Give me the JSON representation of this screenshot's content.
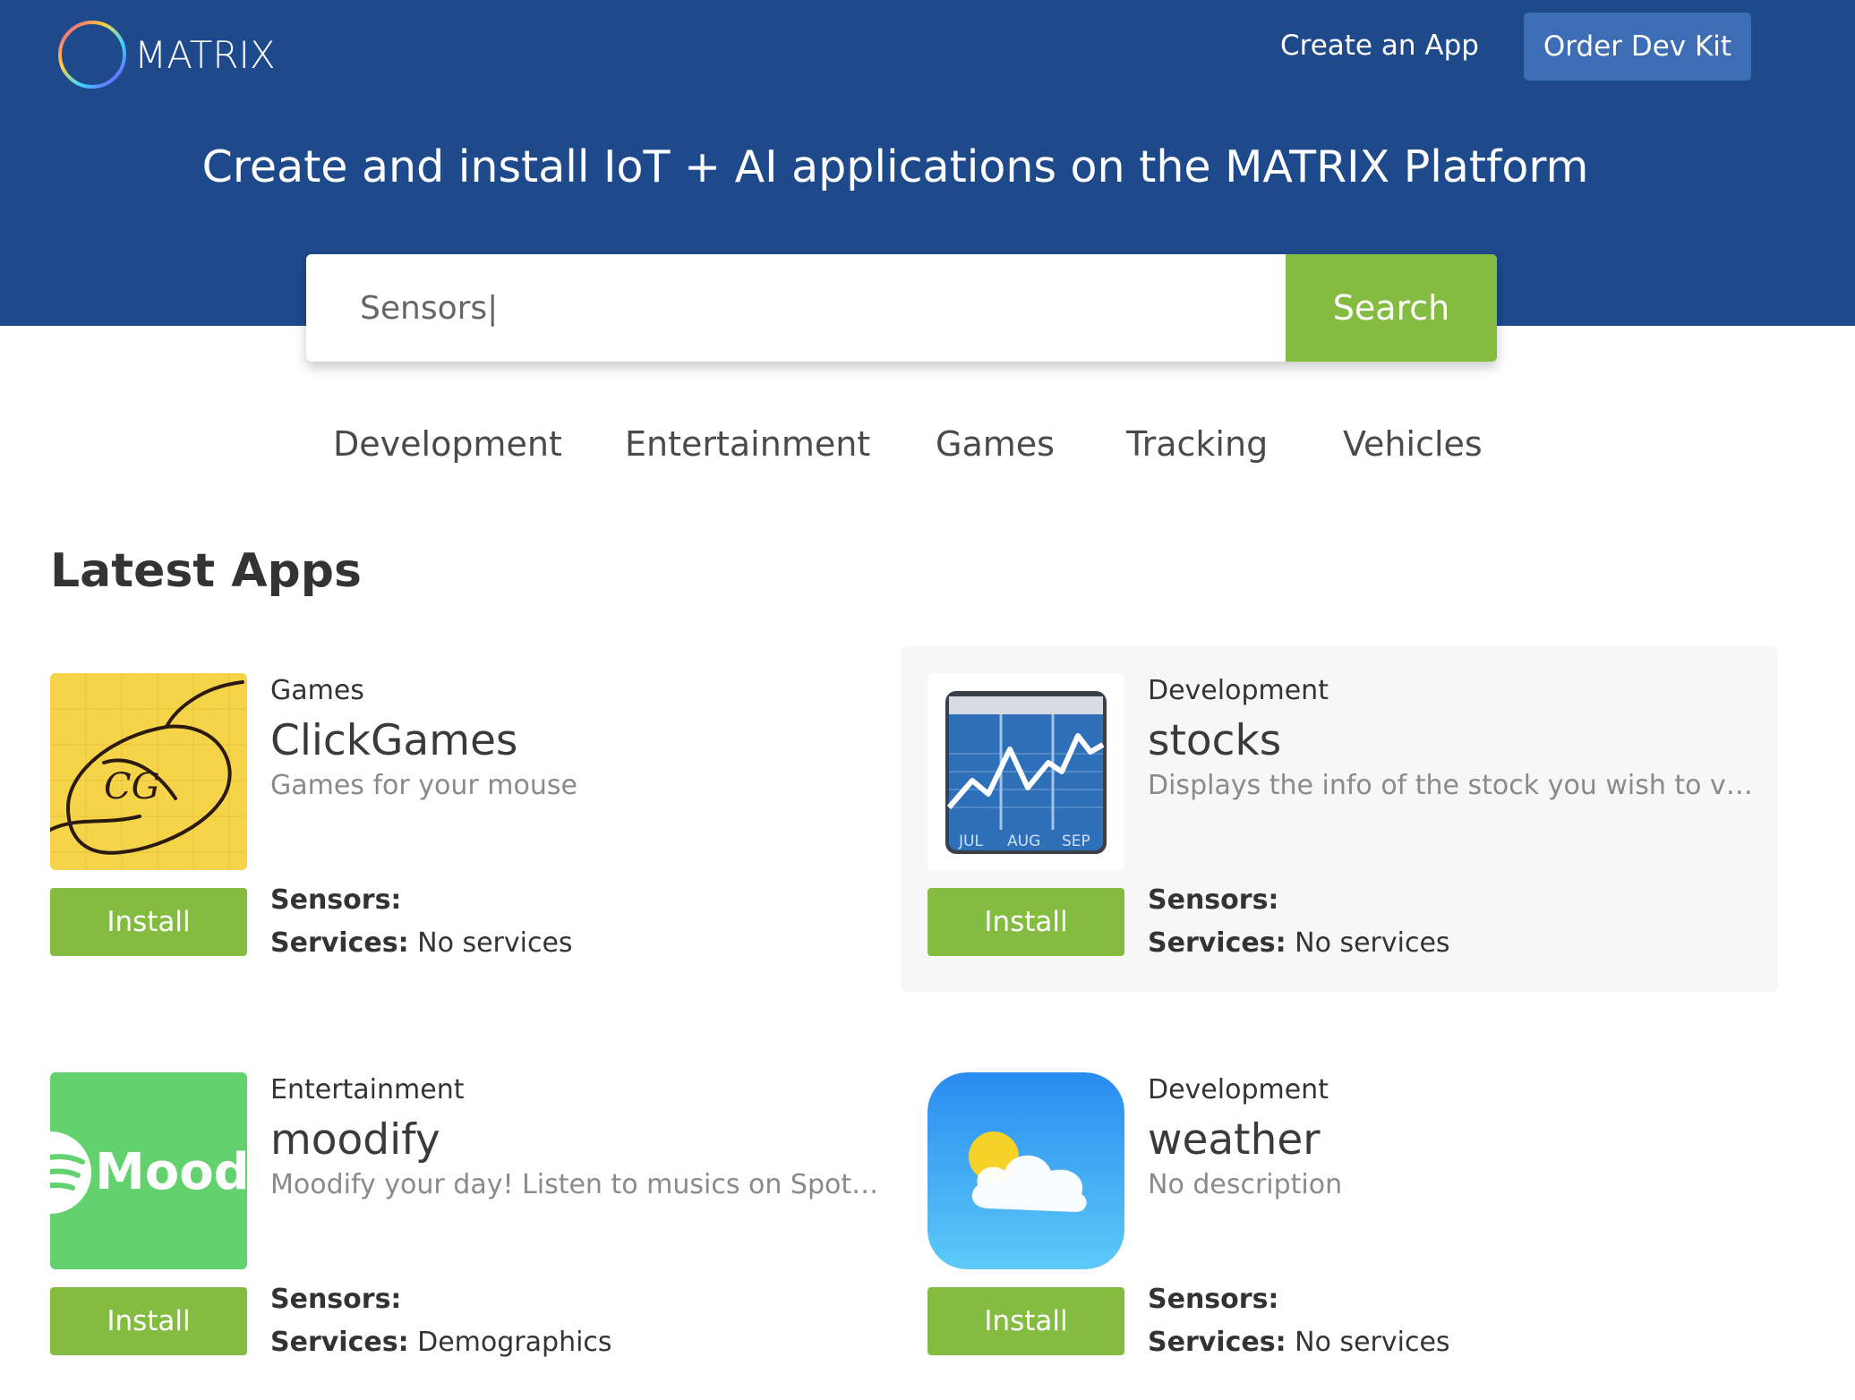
{
  "brand": {
    "name": "MATRIX"
  },
  "nav": {
    "create_app": "Create an App",
    "order_dev_kit": "Order Dev Kit"
  },
  "hero": {
    "tagline": "Create and install IoT + AI applications on the MATRIX Platform"
  },
  "search": {
    "value": "Sensors|",
    "button_label": "Search"
  },
  "categories": [
    "Development",
    "Entertainment",
    "Games",
    "Tracking",
    "Vehicles"
  ],
  "section_title": "Latest Apps",
  "labels": {
    "install": "Install",
    "sensors": "Sensors:",
    "services": "Services:"
  },
  "apps": [
    {
      "category": "Games",
      "name": "ClickGames",
      "description": "Games for your mouse",
      "sensors": "",
      "services": "No services",
      "icon": "clickgames-mouse-icon"
    },
    {
      "category": "Development",
      "name": "stocks",
      "description": "Displays the info of the stock you wish to view.",
      "sensors": "",
      "services": "No services",
      "icon": "stocks-chart-icon",
      "icon_text": [
        "JUL",
        "AUG",
        "SEP"
      ]
    },
    {
      "category": "Entertainment",
      "name": "moodify",
      "description": "Moodify your day! Listen to musics on Spotify ...",
      "sensors": "",
      "services": "Demographics",
      "icon": "moodify-icon",
      "icon_text": "Mood"
    },
    {
      "category": "Development",
      "name": "weather",
      "description": "No description",
      "sensors": "",
      "services": "No services",
      "icon": "weather-sun-cloud-icon"
    }
  ],
  "colors": {
    "header_bg": "#1e4a8c",
    "dev_kit_button": "#3c6db5",
    "accent_green": "#84bc41",
    "highlight_card": "#f7f7f7"
  }
}
